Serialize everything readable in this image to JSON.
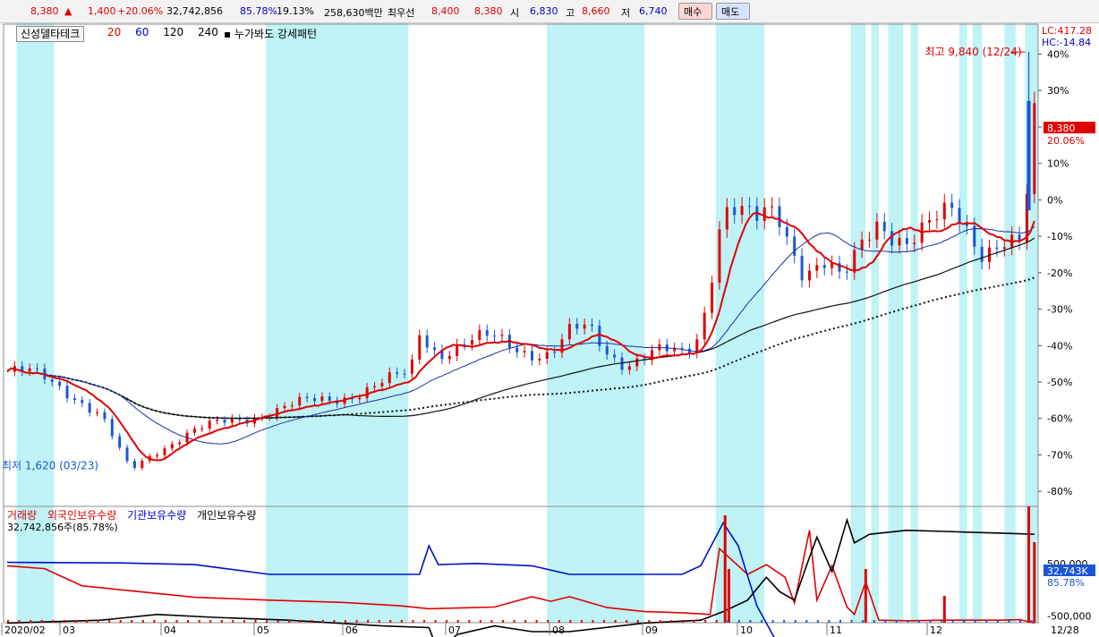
{
  "quote": {
    "price": "8,380",
    "change": "1,400",
    "change_pct": "+20.06%",
    "volume": "32,742,856",
    "ratio1": "85.78%",
    "ratio2": "19.13%",
    "amount": "258,630백만",
    "best_label": "최우선",
    "ask": "8,400",
    "bid": "8,380",
    "open_label": "시",
    "open": "6,830",
    "high_label": "고",
    "high": "8,660",
    "low_label": "저",
    "low": "6,740"
  },
  "buttons": {
    "buy": "매수",
    "sell": "매도"
  },
  "stock_name": "신성델타테크",
  "ma_legend": [
    "20",
    "60",
    "120",
    "240"
  ],
  "pattern_legend": "누가봐도 강세패턴",
  "lc": "LC:417.28",
  "hc": "HC:-14.84",
  "annotations": {
    "high": "최고 9,840 (12/24)",
    "low": "최저 1,620 (03/23)"
  },
  "current_price_tag": "8,380",
  "current_pct_tag": "20.06%",
  "sub_legend": [
    "거래량",
    "외국인보유수량",
    "기관보유수량",
    "개인보유수량"
  ],
  "sub_note": "32,742,856주(85.78%)",
  "sub_tag": "32,743K",
  "sub_tag_pct": "85.78%",
  "sub_axis": [
    "500,000",
    "-500,000"
  ],
  "x_labels": [
    "2020/02",
    "03",
    "04",
    "05",
    "06",
    "07",
    "08",
    "09",
    "10",
    "11",
    "12"
  ],
  "x_right_label": "12/28",
  "colors": {
    "up": "#e00000",
    "down": "#1a56d6",
    "ma20": "#e00000",
    "ma60": "#1a2ea8",
    "ma120": "#111111",
    "ma240": "#111111",
    "highlight": "#bff3f6"
  },
  "chart_data": {
    "type": "candlestick",
    "y_axis_labels": [
      "40%",
      "30%",
      "20%",
      "10%",
      "0%",
      "-10%",
      "-20%",
      "-30%",
      "-40%",
      "-50%",
      "-60%",
      "-70%",
      "-80%"
    ],
    "y_range_pct": [
      -85,
      42
    ],
    "base_price": 7000,
    "close_series": [
      [
        0,
        3700
      ],
      [
        10,
        3650
      ],
      [
        20,
        3550
      ],
      [
        30,
        3400
      ],
      [
        40,
        3150
      ],
      [
        50,
        2850
      ],
      [
        58,
        2300
      ],
      [
        62,
        2000
      ],
      [
        66,
        1800
      ],
      [
        70,
        1900
      ],
      [
        80,
        2200
      ],
      [
        95,
        2500
      ],
      [
        110,
        2650
      ],
      [
        125,
        2800
      ],
      [
        140,
        2950
      ],
      [
        155,
        3050
      ],
      [
        170,
        3150
      ],
      [
        185,
        3300
      ],
      [
        200,
        3450
      ],
      [
        215,
        3650
      ],
      [
        220,
        4450
      ],
      [
        230,
        4100
      ],
      [
        245,
        4250
      ],
      [
        260,
        4300
      ],
      [
        275,
        4150
      ],
      [
        290,
        4050
      ],
      [
        300,
        4400
      ],
      [
        310,
        4500
      ],
      [
        320,
        4100
      ],
      [
        330,
        3900
      ],
      [
        345,
        4050
      ],
      [
        360,
        4000
      ],
      [
        365,
        4150
      ],
      [
        370,
        4500
      ],
      [
        375,
        5500
      ],
      [
        380,
        6600
      ],
      [
        385,
        7000
      ],
      [
        390,
        6800
      ],
      [
        400,
        6500
      ],
      [
        410,
        6700
      ],
      [
        425,
        5700
      ],
      [
        435,
        5900
      ],
      [
        445,
        5400
      ],
      [
        450,
        5600
      ],
      [
        455,
        6000
      ],
      [
        465,
        6600
      ],
      [
        480,
        6300
      ],
      [
        495,
        6500
      ],
      [
        505,
        6700
      ],
      [
        510,
        6500
      ],
      [
        520,
        6100
      ],
      [
        530,
        6300
      ],
      [
        540,
        6100
      ],
      [
        545,
        7200
      ],
      [
        548,
        8400
      ]
    ],
    "high_point": {
      "label": "최고",
      "value": 9840,
      "date": "12/24"
    },
    "low_point": {
      "label": "최저",
      "value": 1620,
      "date": "03/23"
    },
    "highlight_ranges": [
      [
        5,
        25
      ],
      [
        138,
        214
      ],
      [
        288,
        340
      ],
      [
        378,
        404
      ],
      [
        450,
        458
      ],
      [
        461,
        465
      ],
      [
        470,
        478
      ],
      [
        482,
        486
      ],
      [
        508,
        512
      ],
      [
        515,
        520
      ],
      [
        532,
        538
      ],
      [
        543,
        550
      ]
    ],
    "subchart": {
      "series": [
        {
          "name": "외국인보유수량",
          "color": "#e00000",
          "points": [
            [
              0,
              -100
            ],
            [
              20,
              -150
            ],
            [
              40,
              -450
            ],
            [
              70,
              -550
            ],
            [
              100,
              -650
            ],
            [
              140,
              -700
            ],
            [
              180,
              -740
            ],
            [
              210,
              -800
            ],
            [
              225,
              -850
            ],
            [
              260,
              -820
            ],
            [
              280,
              -640
            ],
            [
              290,
              -720
            ],
            [
              300,
              -640
            ],
            [
              320,
              -830
            ],
            [
              340,
              -900
            ],
            [
              360,
              -920
            ],
            [
              375,
              -950
            ],
            [
              380,
              200
            ],
            [
              395,
              -250
            ],
            [
              405,
              -80
            ],
            [
              415,
              -300
            ],
            [
              420,
              -750
            ],
            [
              428,
              520
            ],
            [
              432,
              -700
            ],
            [
              440,
              -100
            ],
            [
              448,
              -820
            ],
            [
              452,
              -950
            ],
            [
              458,
              -380
            ],
            [
              465,
              -1050
            ],
            [
              480,
              -1060
            ],
            [
              500,
              -1050
            ],
            [
              530,
              -1050
            ],
            [
              540,
              -1040
            ],
            [
              548,
              -1100
            ]
          ]
        },
        {
          "name": "기관보유수량",
          "color": "#0010c8",
          "points": [
            [
              0,
              -40
            ],
            [
              60,
              -50
            ],
            [
              100,
              -80
            ],
            [
              140,
              -250
            ],
            [
              220,
              -250
            ],
            [
              225,
              250
            ],
            [
              230,
              -80
            ],
            [
              250,
              -60
            ],
            [
              280,
              -100
            ],
            [
              300,
              -250
            ],
            [
              360,
              -250
            ],
            [
              370,
              -100
            ],
            [
              382,
              650
            ],
            [
              390,
              250
            ],
            [
              400,
              -800
            ],
            [
              410,
              -1400
            ],
            [
              420,
              -1700
            ],
            [
              440,
              -1720
            ],
            [
              548,
              -1720
            ]
          ]
        },
        {
          "name": "개인보유수량",
          "color": "#000000",
          "points": [
            [
              0,
              -1100
            ],
            [
              50,
              -1050
            ],
            [
              80,
              -950
            ],
            [
              110,
              -1000
            ],
            [
              150,
              -1050
            ],
            [
              200,
              -1150
            ],
            [
              225,
              -1180
            ],
            [
              230,
              -1600
            ],
            [
              240,
              -1300
            ],
            [
              260,
              -1150
            ],
            [
              280,
              -1250
            ],
            [
              300,
              -1250
            ],
            [
              340,
              -1100
            ],
            [
              370,
              -1050
            ],
            [
              382,
              -900
            ],
            [
              395,
              -700
            ],
            [
              405,
              -300
            ],
            [
              412,
              -550
            ],
            [
              420,
              -700
            ],
            [
              428,
              50
            ],
            [
              432,
              400
            ],
            [
              440,
              -200
            ],
            [
              448,
              700
            ],
            [
              452,
              300
            ],
            [
              460,
              450
            ],
            [
              480,
              520
            ],
            [
              500,
              500
            ],
            [
              520,
              480
            ],
            [
              540,
              460
            ],
            [
              548,
              450
            ]
          ]
        }
      ]
    }
  }
}
